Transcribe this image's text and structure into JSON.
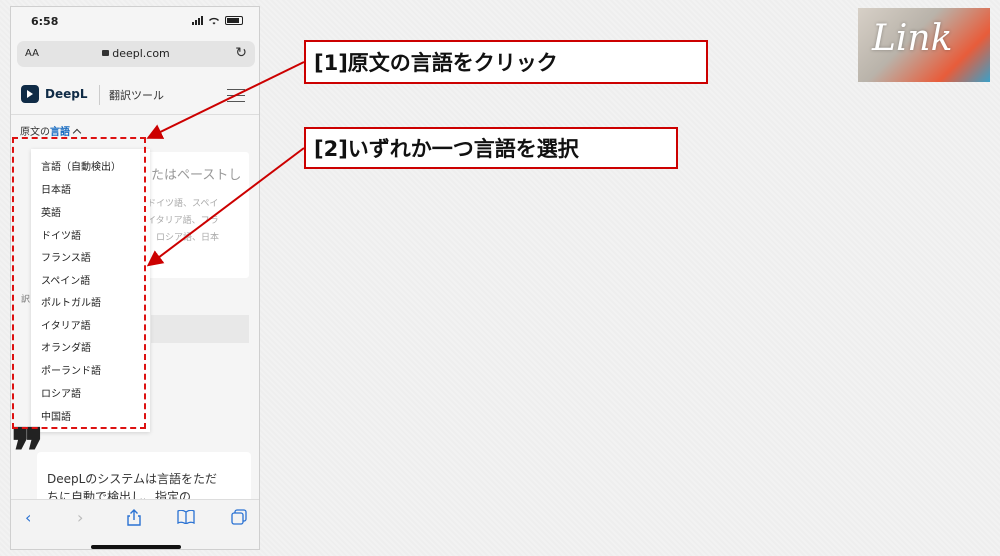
{
  "phone": {
    "status_time": "6:58",
    "url_aa": "AA",
    "url": "deepl.com",
    "brand": "DeepL",
    "subtitle": "翻訳ツール",
    "source_lang_prefix": "原文の",
    "source_lang_selected": "言語",
    "bg_card_title": "たはペーストし",
    "bg_card_lines": [
      "ドイツ語、スペイ",
      "イタリア語、フラ",
      "、ロシア語、日本",
      "。"
    ],
    "bg_stub": "訳",
    "dropdown_items": [
      "言語（自動検出）",
      "日本語",
      "英語",
      "ドイツ語",
      "フランス語",
      "スペイン語",
      "ポルトガル語",
      "イタリア語",
      "オランダ語",
      "ポーランド語",
      "ロシア語",
      "中国語"
    ],
    "quote_mark": "❞",
    "bottom_card_text": "DeepLのシステムは言語をただちに自動で検出し、指定の"
  },
  "callouts": {
    "step1": "[1]原文の言語をクリック",
    "step2": "[2]いずれか一つ言語を選択"
  },
  "logo": {
    "text": "Link"
  },
  "colors": {
    "accent_red": "#cc0000",
    "link_blue": "#1b6dc1",
    "deepl_navy": "#0f2b46",
    "toolbar_blue": "#2a72d3"
  },
  "icons": {
    "toolbar": [
      "back-icon",
      "forward-icon",
      "share-icon",
      "bookmarks-icon",
      "tabs-icon"
    ]
  }
}
